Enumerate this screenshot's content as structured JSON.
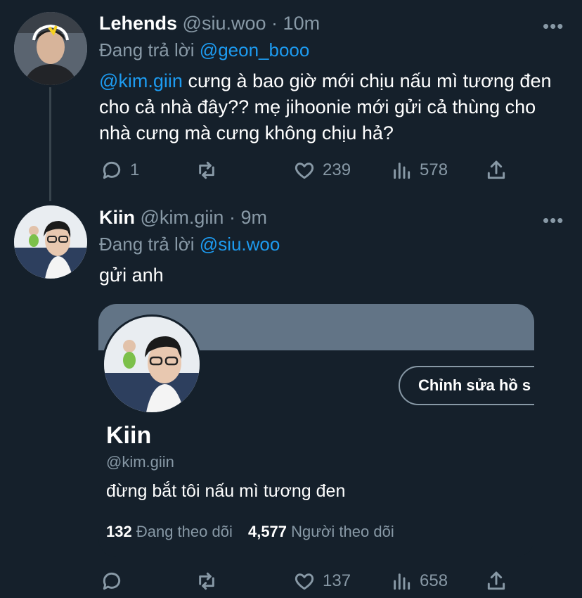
{
  "tweets": [
    {
      "display_name": "Lehends",
      "handle": "@siu.woo",
      "separator": "·",
      "time": "10m",
      "replying_prefix": "Đang trả lời",
      "replying_to": "@geon_booo",
      "mention": "@kim.giin",
      "text_after_mention": " cưng à bao giờ mới chịu nấu mì tương đen cho cả nhà đây?? mẹ jihoonie mới gửi cả thùng cho nhà cưng mà cưng không chịu hả?",
      "replies": "1",
      "retweets": "",
      "likes": "239",
      "views": "578",
      "more": "•••"
    },
    {
      "display_name": "Kiin",
      "handle": "@kim.giin",
      "separator": "·",
      "time": "9m",
      "replying_prefix": "Đang trả lời",
      "replying_to": "@siu.woo",
      "text": "gửi anh",
      "replies": "",
      "retweets": "",
      "likes": "137",
      "views": "658",
      "more": "•••"
    }
  ],
  "profile_card": {
    "edit_button": "Chỉnh sửa hồ s",
    "name": "Kiin",
    "handle": "@kim.giin",
    "bio": "đừng bắt tôi nấu mì tương đen",
    "following_count": "132",
    "following_label": "Đang theo dõi",
    "followers_count": "4,577",
    "followers_label": "Người theo dõi"
  },
  "icons": {
    "reply": "reply-icon",
    "retweet": "retweet-icon",
    "like": "heart-icon",
    "views": "views-icon",
    "share": "share-icon"
  },
  "colors": {
    "background": "#15202b",
    "link": "#1d9bf0",
    "muted": "#8899a6",
    "banner": "#627486"
  }
}
